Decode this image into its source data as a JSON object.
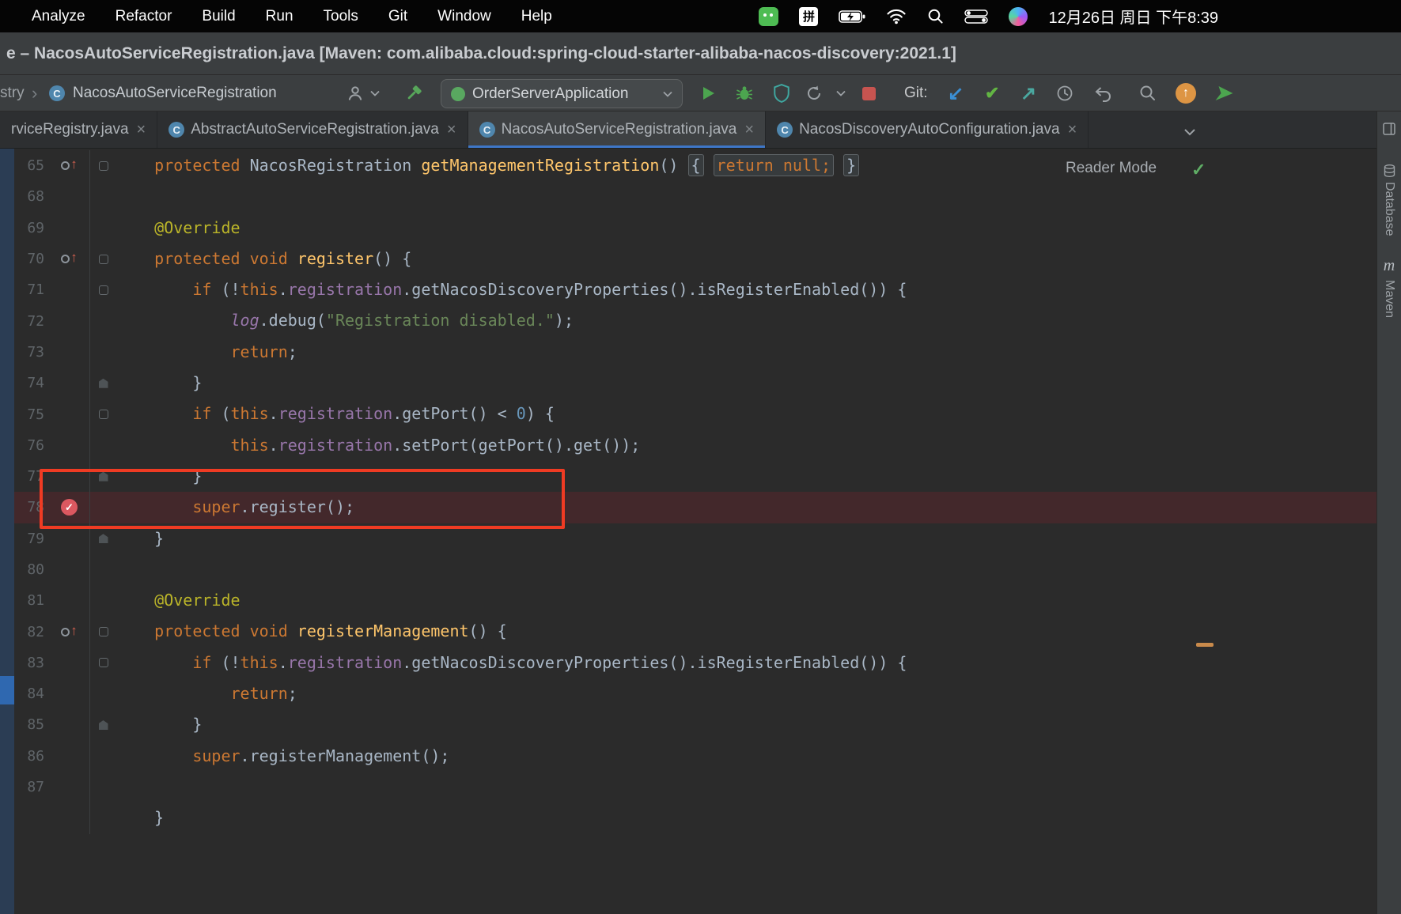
{
  "menu_bar": {
    "items": [
      "Analyze",
      "Refactor",
      "Build",
      "Run",
      "Tools",
      "Git",
      "Window",
      "Help"
    ],
    "input_badge": "拼",
    "datetime": "12月26日 周日 下午8:39"
  },
  "title_bar": {
    "title": "e – NacosAutoServiceRegistration.java [Maven: com.alibaba.cloud:spring-cloud-starter-alibaba-nacos-discovery:2021.1]"
  },
  "toolbar": {
    "breadcrumb_prefix": "stry",
    "class_name": "NacosAutoServiceRegistration",
    "run_config": "OrderServerApplication",
    "git_label": "Git:"
  },
  "tab_bar": {
    "tabs": [
      {
        "label": "rviceRegistry.java",
        "icon": false,
        "active": false
      },
      {
        "label": "AbstractAutoServiceRegistration.java",
        "icon": true,
        "active": false
      },
      {
        "label": "NacosAutoServiceRegistration.java",
        "icon": true,
        "active": true
      },
      {
        "label": "NacosDiscoveryAutoConfiguration.java",
        "icon": true,
        "active": false
      }
    ]
  },
  "right_dock": {
    "items": [
      "Database",
      "Maven"
    ]
  },
  "editor": {
    "reader_mode_label": "Reader Mode",
    "lines": [
      {
        "n": "65",
        "icon": "override",
        "fold": "start",
        "tokens": [
          [
            "    ",
            "p"
          ],
          [
            "protected ",
            "k"
          ],
          [
            "NacosRegistration ",
            "p"
          ],
          [
            "getManagementRegistration",
            "m"
          ],
          [
            "() ",
            "p"
          ],
          [
            "{",
            "pb"
          ],
          [
            " ",
            "p"
          ],
          [
            "return null;",
            "kb"
          ],
          [
            " ",
            "p"
          ],
          [
            "}",
            "pb"
          ]
        ]
      },
      {
        "n": "68",
        "tokens": []
      },
      {
        "n": "69",
        "tokens": [
          [
            "    ",
            "p"
          ],
          [
            "@Override",
            "a"
          ]
        ]
      },
      {
        "n": "70",
        "icon": "override",
        "fold": "start",
        "tokens": [
          [
            "    ",
            "p"
          ],
          [
            "protected void ",
            "k"
          ],
          [
            "register",
            "m"
          ],
          [
            "() {",
            "p"
          ]
        ]
      },
      {
        "n": "71",
        "fold": "start",
        "tokens": [
          [
            "        ",
            "p"
          ],
          [
            "if ",
            "k"
          ],
          [
            "(!",
            "p"
          ],
          [
            "this",
            "k"
          ],
          [
            ".",
            "p"
          ],
          [
            "registration",
            "f"
          ],
          [
            ".getNacosDiscoveryProperties().isRegisterEnabled()) {",
            "p"
          ]
        ]
      },
      {
        "n": "72",
        "tokens": [
          [
            "            ",
            "p"
          ],
          [
            "log",
            "l"
          ],
          [
            ".debug(",
            "p"
          ],
          [
            "\"Registration disabled.\"",
            "s"
          ],
          [
            ");",
            "p"
          ]
        ]
      },
      {
        "n": "73",
        "tokens": [
          [
            "            ",
            "p"
          ],
          [
            "return",
            "k"
          ],
          [
            ";",
            "p"
          ]
        ]
      },
      {
        "n": "74",
        "fold": "end",
        "tokens": [
          [
            "        }",
            "p"
          ]
        ]
      },
      {
        "n": "75",
        "fold": "start",
        "tokens": [
          [
            "        ",
            "p"
          ],
          [
            "if ",
            "k"
          ],
          [
            "(",
            "p"
          ],
          [
            "this",
            "k"
          ],
          [
            ".",
            "p"
          ],
          [
            "registration",
            "f"
          ],
          [
            ".getPort() < ",
            "p"
          ],
          [
            "0",
            "n"
          ],
          [
            ") {",
            "p"
          ]
        ]
      },
      {
        "n": "76",
        "tokens": [
          [
            "            ",
            "p"
          ],
          [
            "this",
            "k"
          ],
          [
            ".",
            "p"
          ],
          [
            "registration",
            "f"
          ],
          [
            ".setPort(getPort().get());",
            "p"
          ]
        ]
      },
      {
        "n": "77",
        "fold": "end",
        "tokens": [
          [
            "        }",
            "p"
          ]
        ]
      },
      {
        "n": "78",
        "icon": "breakpoint",
        "highlight": true,
        "tokens": [
          [
            "        ",
            "p"
          ],
          [
            "super",
            "k"
          ],
          [
            ".register();",
            "p"
          ]
        ]
      },
      {
        "n": "79",
        "fold": "end",
        "tokens": [
          [
            "    }",
            "p"
          ]
        ]
      },
      {
        "n": "80",
        "tokens": []
      },
      {
        "n": "81",
        "tokens": [
          [
            "    ",
            "p"
          ],
          [
            "@Override",
            "a"
          ]
        ]
      },
      {
        "n": "82",
        "icon": "override",
        "fold": "start",
        "tokens": [
          [
            "    ",
            "p"
          ],
          [
            "protected void ",
            "k"
          ],
          [
            "registerManagement",
            "m"
          ],
          [
            "() {",
            "p"
          ]
        ]
      },
      {
        "n": "83",
        "fold": "start",
        "tokens": [
          [
            "        ",
            "p"
          ],
          [
            "if ",
            "k"
          ],
          [
            "(!",
            "p"
          ],
          [
            "this",
            "k"
          ],
          [
            ".",
            "p"
          ],
          [
            "registration",
            "f"
          ],
          [
            ".getNacosDiscoveryProperties().isRegisterEnabled()) {",
            "p"
          ]
        ]
      },
      {
        "n": "84",
        "tokens": [
          [
            "            ",
            "p"
          ],
          [
            "return",
            "k"
          ],
          [
            ";",
            "p"
          ]
        ]
      },
      {
        "n": "85",
        "fold": "end",
        "tokens": [
          [
            "        }",
            "p"
          ]
        ]
      },
      {
        "n": "86",
        "tokens": [
          [
            "        ",
            "p"
          ],
          [
            "super",
            "k"
          ],
          [
            ".registerManagement();",
            "p"
          ]
        ]
      },
      {
        "n": "87",
        "tokens": []
      },
      {
        "n": "",
        "tokens": [
          [
            "    }",
            "p"
          ]
        ]
      }
    ]
  },
  "colors": {
    "keyword": "#cc7832",
    "method": "#ffc66b",
    "field": "#9876aa",
    "string": "#6a8759",
    "number": "#6897bb",
    "annotation": "#bbb529",
    "editor_text": "#a9b7c6",
    "editor_background": "#2b2b2b",
    "breakpoint_line": "#43282b",
    "breakpoint_icon": "#db5860",
    "annotation_rectangle": "#ef3b23",
    "active_tab_underline": "#3e76c6",
    "run_green": "#4ca54f",
    "stop_red": "#c75450"
  }
}
